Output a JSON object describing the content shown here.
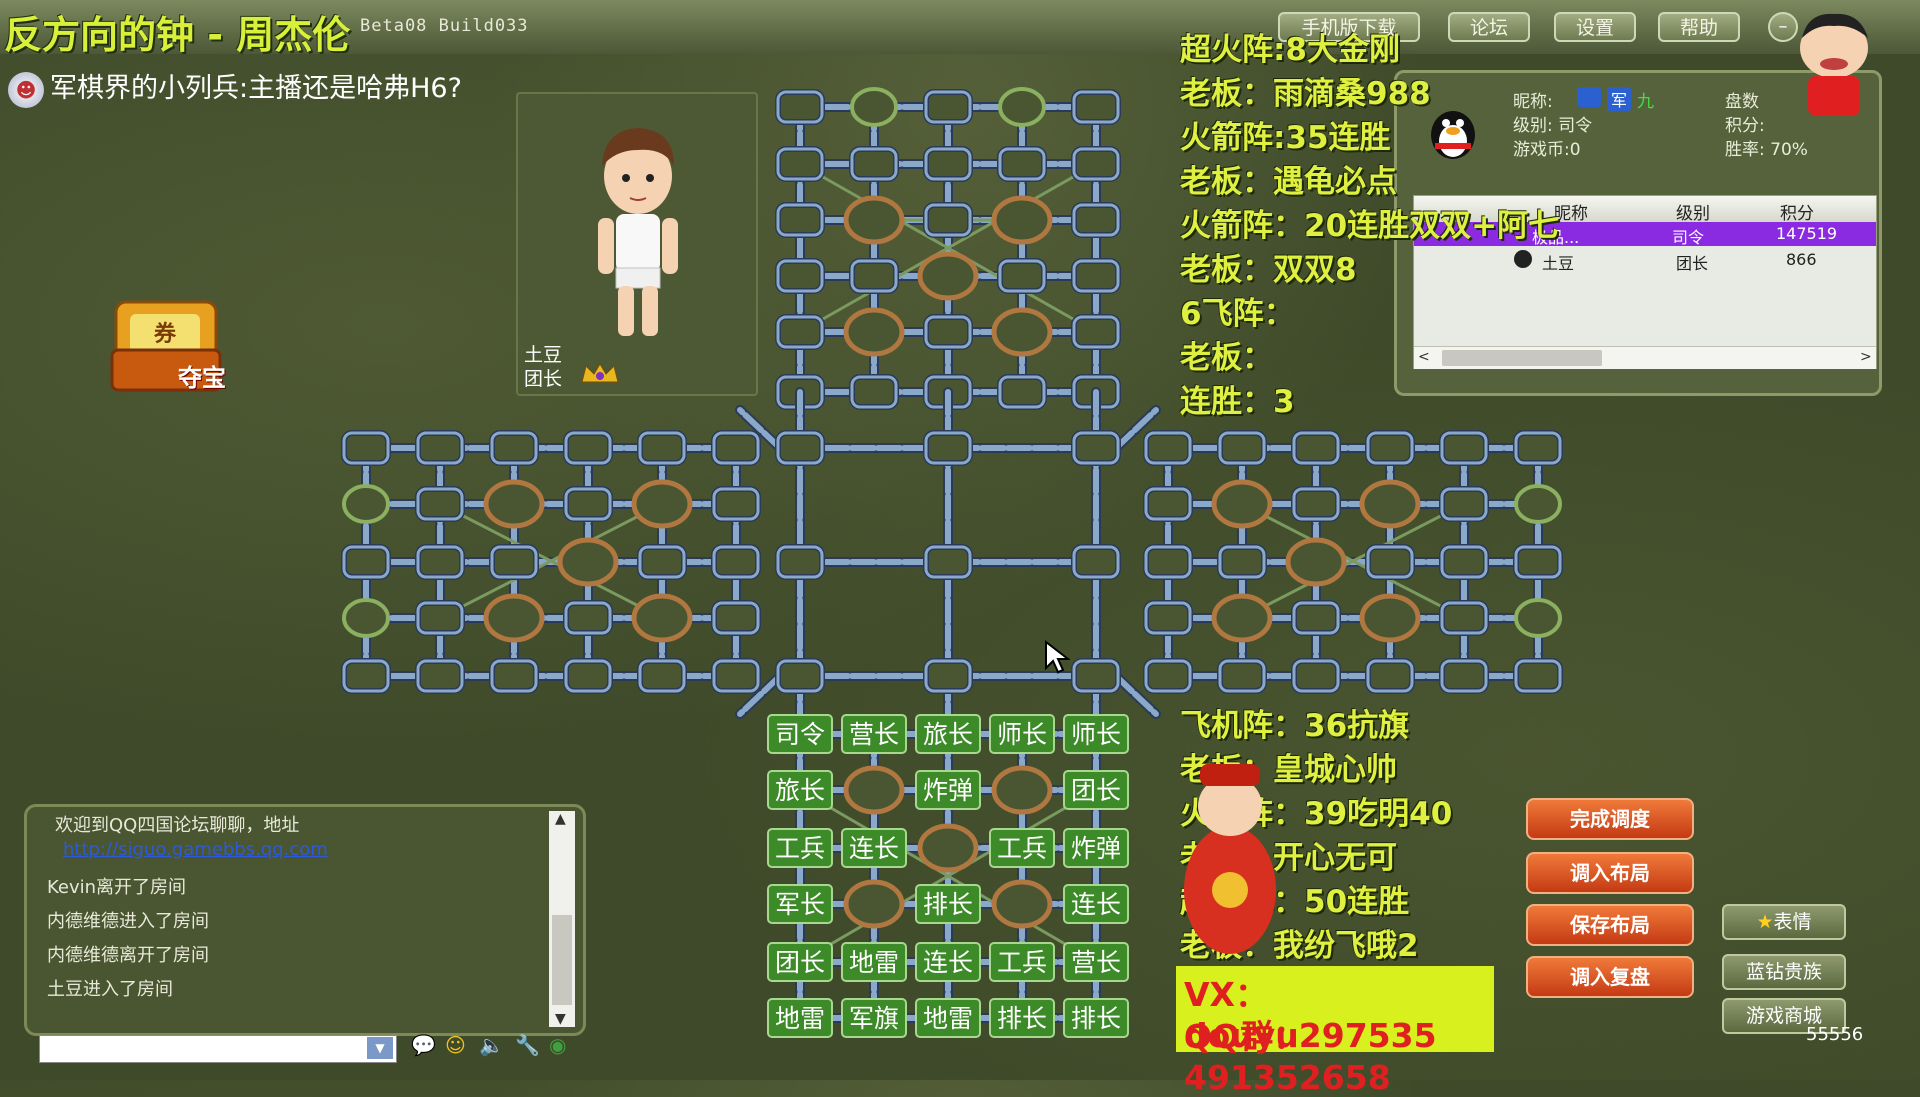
{
  "window": {
    "title_overlay": "反方向的钟 - 周杰伦",
    "app_version": "Beta08 Build033",
    "top_buttons": [
      "手机版下载",
      "论坛",
      "设置",
      "帮助"
    ]
  },
  "streamer_chat": "军棋界的小列兵:主播还是哈弗H6?",
  "player_card": {
    "name": "土豆",
    "rank": "团长"
  },
  "treasure": {
    "label": "夺宝",
    "coupon": "券"
  },
  "info_panel": {
    "nickname_label": "昵称:",
    "nickname_badges": [
      "军",
      "九"
    ],
    "level_label": "级别: 司令",
    "coins_label": "游戏币:0",
    "games_label": "盘数",
    "points_label": "积分:",
    "winrate_label": "胜率: 70%",
    "table": {
      "headers": [
        "昵称",
        "级别",
        "积分"
      ],
      "rows": [
        {
          "name": "极品...",
          "rank": "司令",
          "score": "147519",
          "selected": true
        },
        {
          "name": "土豆",
          "rank": "团长",
          "score": "866",
          "selected": false
        }
      ]
    }
  },
  "overlay_top": [
    "超火阵:8大金刚",
    "老板：雨滴桑988",
    "火箭阵:35连胜",
    "老板：遇龟必点",
    "火箭阵：20连胜双双+阿七",
    "老板：双双8",
    "6飞阵：",
    "老板：",
    "连胜：3"
  ],
  "overlay_bottom": [
    "飞机阵：36抗旗",
    "老板：皇城心帅",
    "火箭阵：39吃明40",
    "老板：开心无可",
    "超火阵：50连胜",
    "老板：我纷飞哦2"
  ],
  "contact": {
    "vx": "VX：douyu297535",
    "qq": "QQ群：491352658"
  },
  "pieces": [
    [
      "司令",
      "营长",
      "旅长",
      "师长",
      "师长"
    ],
    [
      "旅长",
      "",
      "炸弹",
      "",
      "团长"
    ],
    [
      "工兵",
      "连长",
      "",
      "工兵",
      "炸弹"
    ],
    [
      "军长",
      "",
      "排长",
      "",
      "连长"
    ],
    [
      "团长",
      "地雷",
      "连长",
      "工兵",
      "营长"
    ],
    [
      "地雷",
      "军旗",
      "地雷",
      "排长",
      "排长"
    ]
  ],
  "action_buttons": [
    "完成调度",
    "调入布局",
    "保存布局",
    "调入复盘"
  ],
  "side_buttons": [
    "表情",
    "蓝钻贵族",
    "游戏商城"
  ],
  "chat": {
    "welcome": "欢迎到QQ四国论坛聊聊，地址",
    "link": "http://siguo.gamebbs.qq.com",
    "lines": [
      "Kevin离开了房间",
      "内德维德进入了房间",
      "内德维德离开了房间",
      "土豆进入了房间"
    ]
  },
  "score_counter": "55556",
  "colors": {
    "board_line": "#8aa8c8",
    "piece_bg": "#3c8a28",
    "overlay_yellow": "#e0f040",
    "vx_bg": "#d8f01e",
    "vx_text": "#e02020",
    "selected_row": "#8a2be2"
  }
}
